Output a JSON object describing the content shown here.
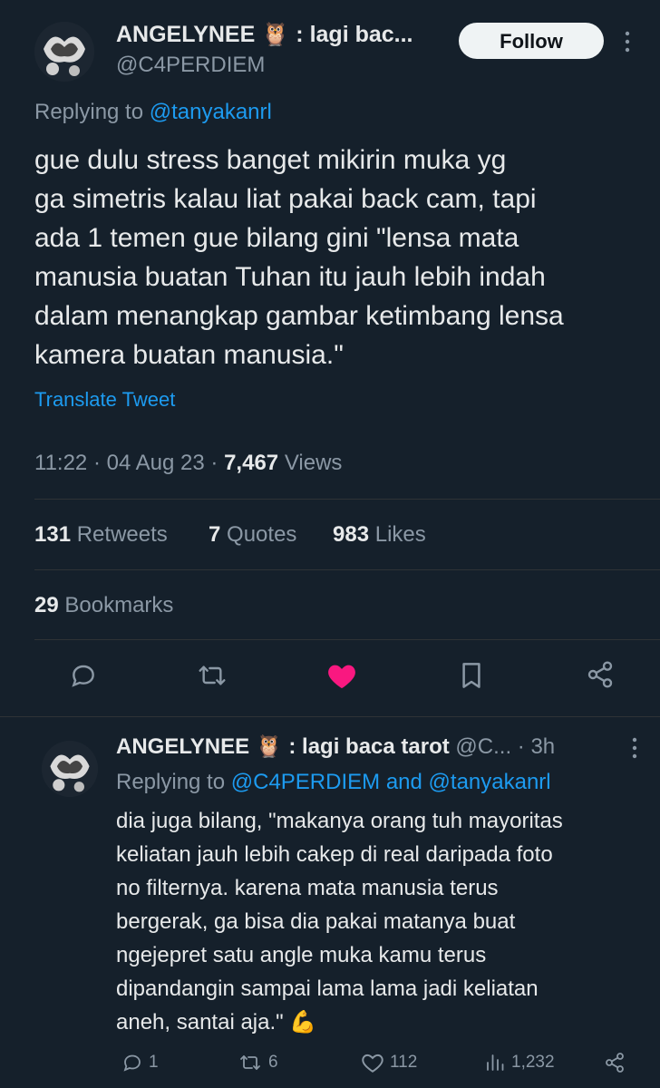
{
  "tweet": {
    "author": {
      "display_name": "ANGELYNEE 🦉 : lagi bac...",
      "handle": "@C4PERDIEM"
    },
    "follow_label": "Follow",
    "more_icon": "more-vertical-icon",
    "replying_prefix": "Replying to",
    "replying_to": "@tanyakanrl",
    "text_lines": [
      "gue dulu stress banget mikirin muka yg",
      "ga simetris kalau liat pakai back cam, tapi",
      "ada 1 temen gue bilang gini \"lensa mata",
      "manusia buatan Tuhan itu jauh lebih indah",
      "dalam menangkap gambar ketimbang lensa",
      "kamera buatan manusia.\""
    ],
    "translate_label": "Translate Tweet",
    "time": "11:22",
    "date": "04 Aug 23",
    "views_count": "7,467",
    "views_label": "Views",
    "retweets_count": "131",
    "retweets_label": "Retweets",
    "quotes_count": "7",
    "quotes_label": "Quotes",
    "likes_count": "983",
    "likes_label": "Likes",
    "bookmarks_count": "29",
    "bookmarks_label": "Bookmarks",
    "actions": [
      "reply-icon",
      "retweet-icon",
      "like-icon",
      "bookmark-icon",
      "share-icon"
    ],
    "like_color": "#f91880"
  },
  "reply": {
    "display_name": "ANGELYNEE 🦉 : lagi baca tarot",
    "handle": "@C...",
    "time": "· 3h",
    "replying_prefix": "Replying to",
    "replying_to_1": "@C4PERDIEM",
    "replying_and": "and",
    "replying_to_2": "@tanyakanrl",
    "text_lines": [
      "dia juga bilang, \"makanya orang tuh mayoritas",
      "keliatan jauh lebih cakep di real daripada foto",
      "no filternya. karena mata manusia terus",
      "bergerak, ga bisa dia pakai matanya buat",
      "ngejepret satu angle muka kamu terus",
      "dipandangin sampai lama lama jadi keliatan",
      "aneh, santai aja.\" 💪"
    ],
    "reply_count": "1",
    "retweet_count": "6",
    "like_count": "112",
    "views_count": "1,232"
  },
  "colors": {
    "background": "#15202b",
    "accent": "#1d9bf0",
    "muted": "#8b98a5"
  }
}
